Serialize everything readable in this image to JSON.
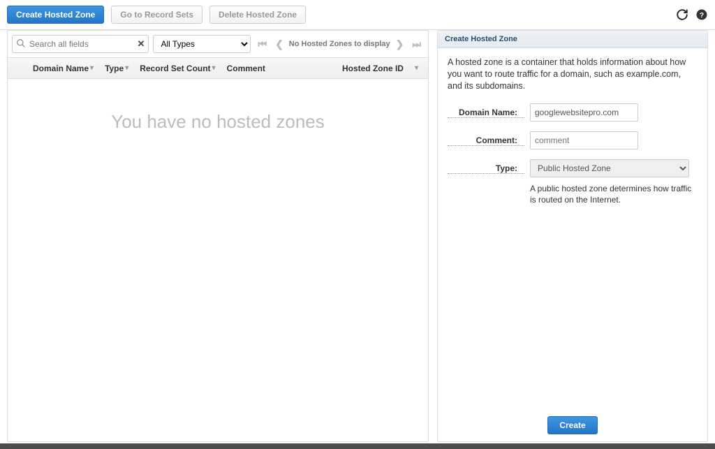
{
  "toolbar": {
    "create_hosted_zone": "Create Hosted Zone",
    "go_to_record_sets": "Go to Record Sets",
    "delete_hosted_zone": "Delete Hosted Zone"
  },
  "filter": {
    "search_placeholder": "Search all fields",
    "type_options": [
      "All Types"
    ],
    "type_selected": "All Types",
    "pager_text": "No Hosted Zones to display"
  },
  "columns": {
    "domain_name": "Domain Name",
    "type": "Type",
    "record_set_count": "Record Set Count",
    "comment": "Comment",
    "hosted_zone_id": "Hosted Zone ID"
  },
  "empty_message": "You have no hosted zones",
  "right_panel": {
    "title": "Create Hosted Zone",
    "description": "A hosted zone is a container that holds information about how you want to route traffic for a domain, such as example.com, and its subdomains.",
    "labels": {
      "domain_name": "Domain Name:",
      "comment": "Comment:",
      "type": "Type:"
    },
    "values": {
      "domain_name": "googlewebsitepro.com",
      "comment_placeholder": "comment",
      "type_selected": "Public Hosted Zone",
      "type_options": [
        "Public Hosted Zone"
      ]
    },
    "helper": "A public hosted zone determines how traffic is routed on the Internet.",
    "create_button": "Create"
  }
}
